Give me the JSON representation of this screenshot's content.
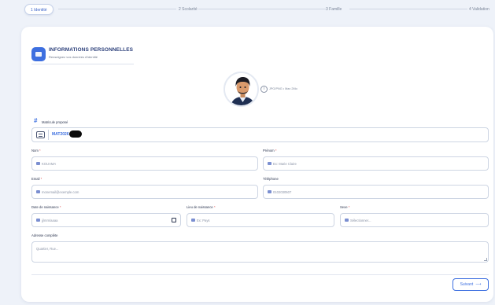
{
  "stepper": {
    "steps": [
      {
        "label": "1 Identité",
        "active": true
      },
      {
        "label": "2 Scolarité",
        "active": false
      },
      {
        "label": "3 Famille",
        "active": false
      },
      {
        "label": "4 Validation",
        "active": false
      }
    ]
  },
  "section": {
    "title": "INFORMATIONS PERSONNELLES",
    "subtitle": "Renseignez vos données d'identité"
  },
  "photo": {
    "hint": "JPG/PNG • Max 2Mo"
  },
  "matricule": {
    "label": "Matricule proposé",
    "value": "MAT2026"
  },
  "fields": {
    "nom": {
      "label": "Nom",
      "required": "*",
      "value": "KOUAMA"
    },
    "prenom": {
      "label": "Prénom",
      "required": "*",
      "placeholder": "Ex: Marie Claire"
    },
    "email": {
      "label": "Email",
      "required": "*",
      "placeholder": "monemail@exemple.com"
    },
    "telephone": {
      "label": "Téléphone",
      "placeholder": "0102030507"
    },
    "date_naissance": {
      "label": "Date de naissance",
      "required": "*",
      "placeholder": "jj/mm/aaaa"
    },
    "lieu_naissance": {
      "label": "Lieu de naissance",
      "required": "*",
      "placeholder": "Ex: Pays"
    },
    "sexe": {
      "label": "Sexe",
      "required": "*",
      "selected": "Sélectionner..."
    },
    "adresse": {
      "label": "Adresse complète",
      "placeholder": "Quartier, Rue..."
    }
  },
  "actions": {
    "next_label": "Suivant",
    "next_arrow": "⟶"
  },
  "colors": {
    "accent": "#3d6fe0",
    "background": "#eef2f9",
    "required": "#e04848"
  }
}
